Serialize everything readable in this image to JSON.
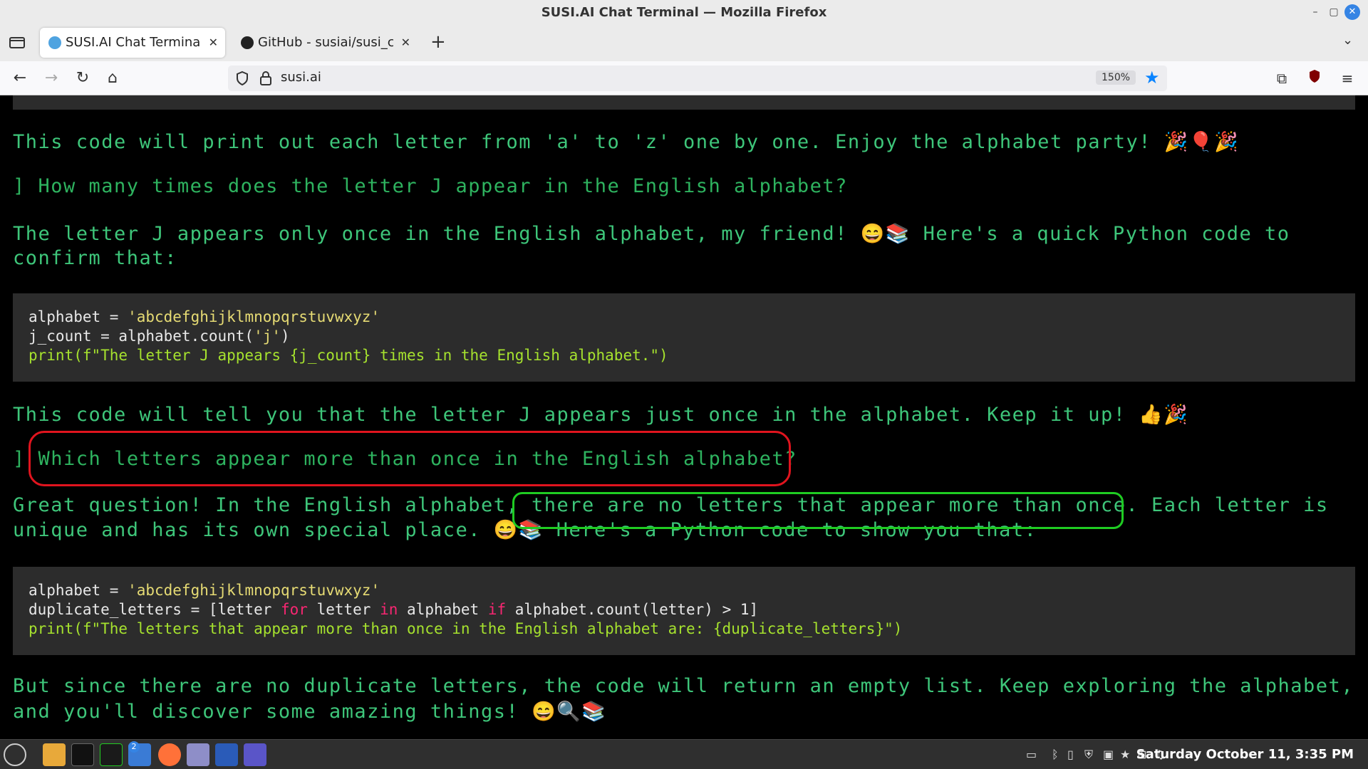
{
  "window": {
    "title": "SUSI.AI Chat Terminal — Mozilla Firefox"
  },
  "tabs": [
    {
      "label": "SUSI.AI Chat Terminal",
      "active": true
    },
    {
      "label": "GitHub - susiai/susi_chat",
      "active": false
    }
  ],
  "navbar": {
    "url": "susi.ai",
    "zoom": "150%"
  },
  "conversation": {
    "line1": "This code will print out each letter from 'a' to 'z' one by one. Enjoy the alphabet party! 🎉🎈🎉",
    "prompt1": "] How many times does the letter J appear in the English alphabet?",
    "answer1a": "The letter J appears only once in the English alphabet, my friend! 😄📚 Here's a quick Python code to",
    "answer1b": "confirm that:",
    "code1": [
      "alphabet = ",
      "'abcdefghijklmnopqrstuvwxyz'",
      "j_count = alphabet.count(",
      "'j'",
      ")",
      "print(f\"The letter J appears {j_count} times in the English alphabet.\")"
    ],
    "line2": "This code will tell you that the letter J appears just once in the alphabet. Keep it up! 👍🎉",
    "prompt2_bracket": "]",
    "prompt2": "Which letters appear more than once in the English alphabet?",
    "answer2a_pre": "Great question! In the English alphabet,",
    "answer2a_highlight": "there are no letters that appear more than once.",
    "answer2a_post": "Each letter is",
    "answer2b": "unique and has its own special place. 😄📚 Here's a Python code to show you that:",
    "code2": {
      "l1a": "alphabet = ",
      "l1b": "'abcdefghijklmnopqrstuvwxyz'",
      "l2a": "duplicate_letters = [letter ",
      "l2kw1": "for",
      "l2b": " letter ",
      "l2kw2": "in",
      "l2c": " alphabet ",
      "l2kw3": "if",
      "l2d": " alphabet.count(letter) > 1]",
      "l3": "print(f\"The letters that appear more than once in the English alphabet are: {duplicate_letters}\")"
    },
    "line3a": "But since there are no duplicate letters, the code will return an empty list. Keep exploring the alphabet,",
    "line3b": "and you'll discover some amazing things! 😄🔍📚"
  },
  "taskbar": {
    "clock": "Saturday October 11, 3:35 PM",
    "badge": "2"
  },
  "colors": {
    "terminal_green": "#3ec67a",
    "highlight_red": "#e0141e",
    "highlight_green": "#1fcc22",
    "accent": "#0a84ff"
  }
}
